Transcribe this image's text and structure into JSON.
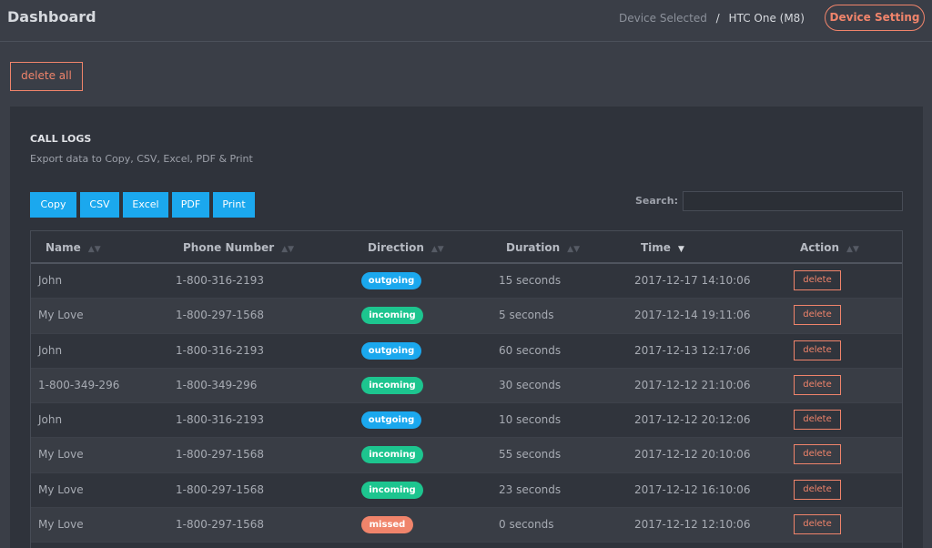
{
  "header": {
    "title": "Dashboard",
    "device_selected_label": "Device Selected",
    "separator": "/",
    "device_name": "HTC One (M8)",
    "device_setting_label": "Device Setting"
  },
  "actions": {
    "delete_all_label": "delete all"
  },
  "panel": {
    "title": "CALL LOGS",
    "subtitle": "Export data to Copy, CSV, Excel, PDF & Print",
    "export_buttons": [
      "Copy",
      "CSV",
      "Excel",
      "PDF",
      "Print"
    ],
    "search_label": "Search:",
    "search_value": ""
  },
  "table": {
    "columns": [
      "Name",
      "Phone Number",
      "Direction",
      "Duration",
      "Time",
      "Action"
    ],
    "sorted_column": "Time",
    "rows": [
      {
        "name": "John",
        "phone": "1-800-316-2193",
        "direction": "outgoing",
        "duration": "15 seconds",
        "time": "2017-12-17 14:10:06",
        "action": "delete"
      },
      {
        "name": "My Love",
        "phone": "1-800-297-1568",
        "direction": "incoming",
        "duration": "5 seconds",
        "time": "2017-12-14 19:11:06",
        "action": "delete"
      },
      {
        "name": "John",
        "phone": "1-800-316-2193",
        "direction": "outgoing",
        "duration": "60 seconds",
        "time": "2017-12-13 12:17:06",
        "action": "delete"
      },
      {
        "name": "1-800-349-296",
        "phone": "1-800-349-296",
        "direction": "incoming",
        "duration": "30 seconds",
        "time": "2017-12-12 21:10:06",
        "action": "delete"
      },
      {
        "name": "John",
        "phone": "1-800-316-2193",
        "direction": "outgoing",
        "duration": "10 seconds",
        "time": "2017-12-12 20:12:06",
        "action": "delete"
      },
      {
        "name": "My Love",
        "phone": "1-800-297-1568",
        "direction": "incoming",
        "duration": "55 seconds",
        "time": "2017-12-12 20:10:06",
        "action": "delete"
      },
      {
        "name": "My Love",
        "phone": "1-800-297-1568",
        "direction": "incoming",
        "duration": "23 seconds",
        "time": "2017-12-12 16:10:06",
        "action": "delete"
      },
      {
        "name": "My Love",
        "phone": "1-800-297-1568",
        "direction": "missed",
        "duration": "0 seconds",
        "time": "2017-12-12 12:10:06",
        "action": "delete"
      }
    ]
  },
  "colors": {
    "background": "#3a3e47",
    "panel": "#2f333b",
    "accent": "#f0846b",
    "primary": "#1ba8ee",
    "incoming": "#1dc58f",
    "outgoing": "#1ba8ee",
    "missed": "#f0846b"
  }
}
